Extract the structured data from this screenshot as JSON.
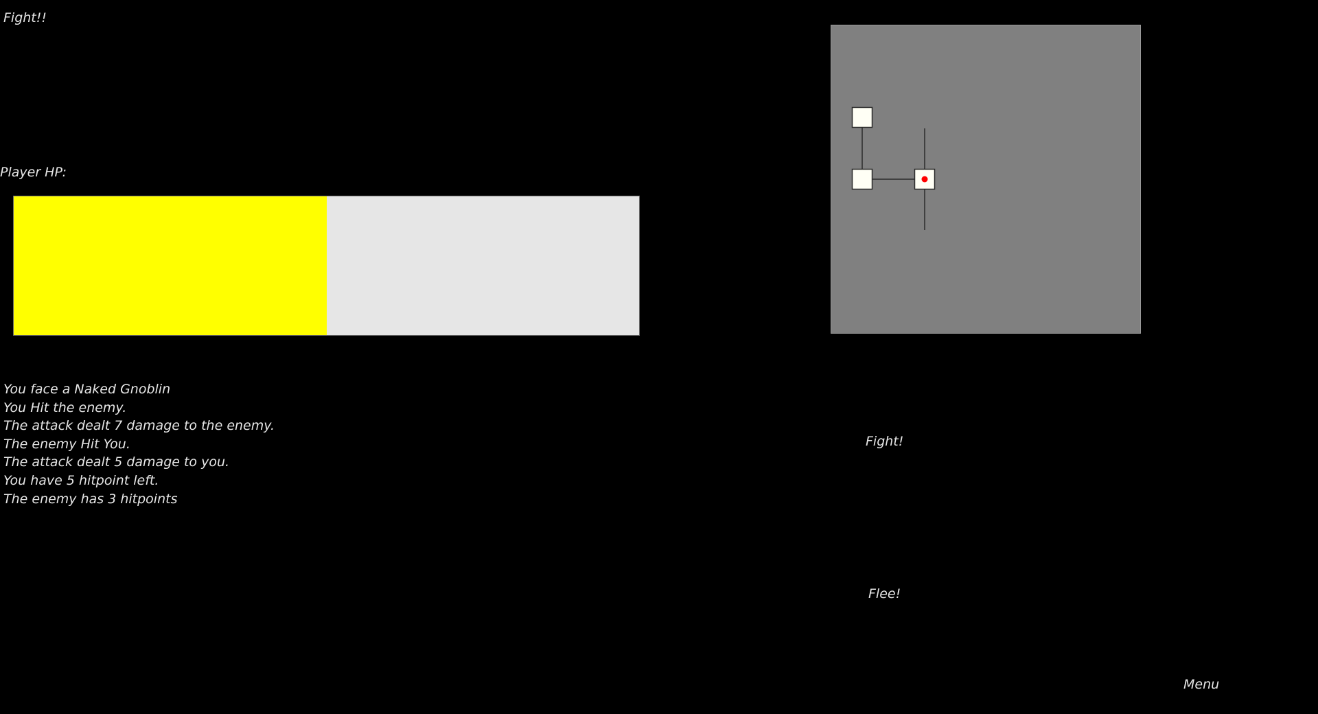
{
  "header": {
    "title": "Fight!!"
  },
  "player": {
    "hp_label": "Player HP:",
    "hp_fraction": 0.5,
    "hp_fill_color": "#ffff00",
    "hp_empty_color": "#e6e6e6"
  },
  "log": [
    "You face a  Naked Gnoblin",
    "You Hit the enemy.",
    "The attack dealt 7 damage to the enemy.",
    "The enemy Hit You.",
    "The attack dealt 5 damage to you.",
    "You have 5 hitpoint left.",
    "The enemy has 3 hitpoints"
  ],
  "map": {
    "background": "#808080",
    "room_color": "#fffff5",
    "player_marker_color": "#ff0000",
    "rooms": [
      {
        "name": "room-north-west",
        "col": 0,
        "row": 0,
        "current": false
      },
      {
        "name": "room-west",
        "col": 0,
        "row": 1,
        "current": false
      },
      {
        "name": "room-current",
        "col": 1,
        "row": 1,
        "current": true
      }
    ],
    "connections": [
      {
        "name": "corridor-nw-w",
        "from": 0,
        "to": 1
      },
      {
        "name": "corridor-w-current",
        "from": 1,
        "to": 2
      }
    ],
    "stubs": [
      {
        "name": "corridor-stub-north",
        "room": 2,
        "dir": "up"
      },
      {
        "name": "corridor-stub-south",
        "room": 2,
        "dir": "down"
      }
    ]
  },
  "actions": {
    "fight_label": "Fight!",
    "flee_label": "Flee!",
    "menu_label": "Menu"
  }
}
